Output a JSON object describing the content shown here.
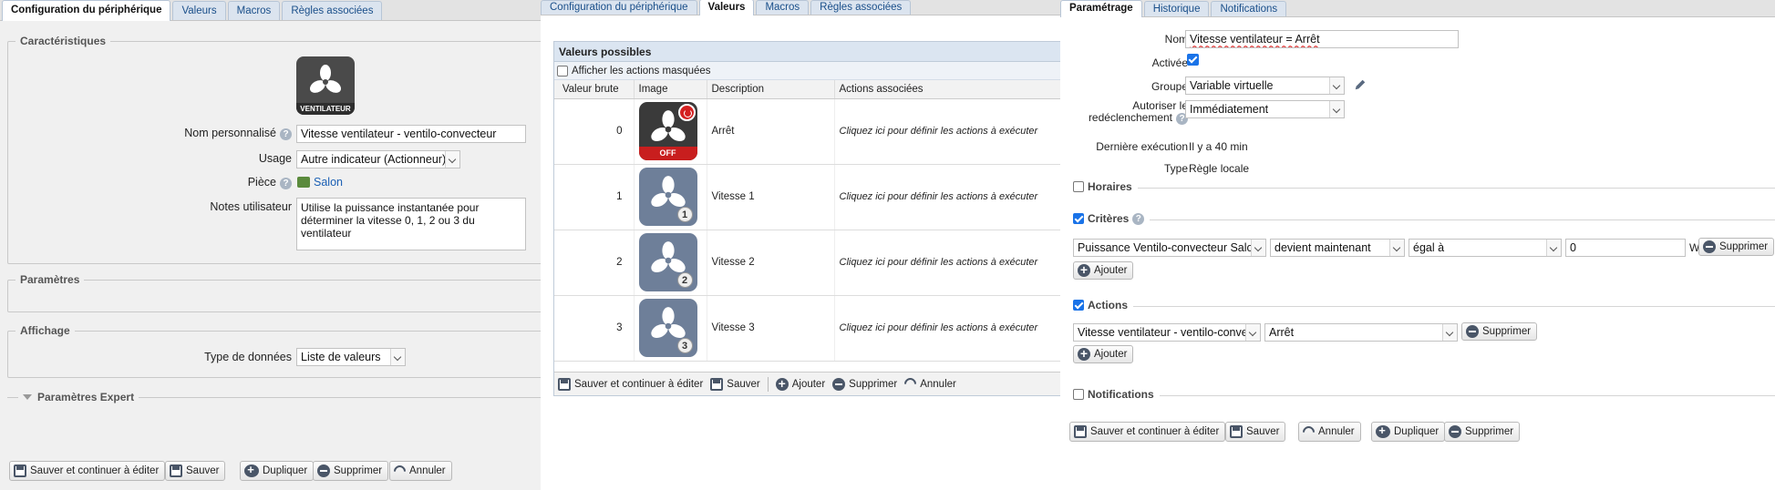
{
  "panel1": {
    "tabs": [
      "Configuration du périphérique",
      "Valeurs",
      "Macros",
      "Règles associées"
    ],
    "sections": {
      "caracteristiques": "Caractéristiques",
      "parametres": "Paramètres",
      "affichage": "Affichage",
      "expert": "Paramètres Expert"
    },
    "device_icon_caption": "VENTILATEUR",
    "fields": {
      "nom_label": "Nom personnalisé",
      "nom_value": "Vitesse ventilateur - ventilo-convecteur",
      "usage_label": "Usage",
      "usage_value": "Autre indicateur (Actionneur)",
      "piece_label": "Pièce",
      "piece_value": "Salon",
      "notes_label": "Notes utilisateur",
      "notes_value": "Utilise la puissance instantanée pour déterminer la vitesse 0, 1, 2 ou 3 du ventilateur",
      "type_label": "Type de données",
      "type_value": "Liste de valeurs"
    },
    "buttons": {
      "save_continue": "Sauver et continuer à éditer",
      "save": "Sauver",
      "duplicate": "Dupliquer",
      "delete": "Supprimer",
      "cancel": "Annuler"
    }
  },
  "panel2": {
    "tabs": [
      "Configuration du périphérique",
      "Valeurs",
      "Macros",
      "Règles associées"
    ],
    "title": "Valeurs possibles",
    "show_hidden": "Afficher les actions masquées",
    "columns": [
      "Valeur brute",
      "Image",
      "Description",
      "Actions associées"
    ],
    "rows": [
      {
        "raw": "0",
        "desc": "Arrêt",
        "action": "Cliquez ici pour définir les actions à exécuter",
        "badge": "OFF"
      },
      {
        "raw": "1",
        "desc": "Vitesse 1",
        "action": "Cliquez ici pour définir les actions à exécuter",
        "badge": "1"
      },
      {
        "raw": "2",
        "desc": "Vitesse 2",
        "action": "Cliquez ici pour définir les actions à exécuter",
        "badge": "2"
      },
      {
        "raw": "3",
        "desc": "Vitesse 3",
        "action": "Cliquez ici pour définir les actions à exécuter",
        "badge": "3"
      }
    ],
    "footer": {
      "save_continue": "Sauver et continuer à éditer",
      "save": "Sauver",
      "add": "Ajouter",
      "delete": "Supprimer",
      "cancel": "Annuler"
    }
  },
  "panel3": {
    "tabs": [
      "Paramétrage",
      "Historique",
      "Notifications"
    ],
    "nom_label": "Nom",
    "nom_value": "Vitesse ventilateur = Arrêt",
    "active_label": "Activée",
    "groupe_label": "Groupe",
    "groupe_value": "Variable virtuelle",
    "autoriser_label_1": "Autoriser le",
    "autoriser_label_2": "redéclenchement",
    "autoriser_value": "Immédiatement",
    "derniere_label": "Dernière exécution",
    "derniere_value": "Il y a 40 min",
    "type_label": "Type",
    "type_value": "Règle locale",
    "horaires": "Horaires",
    "criteres": "Critères",
    "crit_device": "Puissance Ventilo-convecteur Salon",
    "crit_op": "devient maintenant",
    "crit_cmp": "égal à",
    "crit_value": "0",
    "crit_unit": "W",
    "actions": "Actions",
    "act_device": "Vitesse ventilateur - ventilo-convec",
    "act_value": "Arrêt",
    "notifications": "Notifications",
    "add": "Ajouter",
    "delete": "Supprimer",
    "buttons": {
      "save_continue": "Sauver et continuer à éditer",
      "save": "Sauver",
      "cancel": "Annuler",
      "duplicate": "Dupliquer",
      "delete": "Supprimer"
    }
  }
}
